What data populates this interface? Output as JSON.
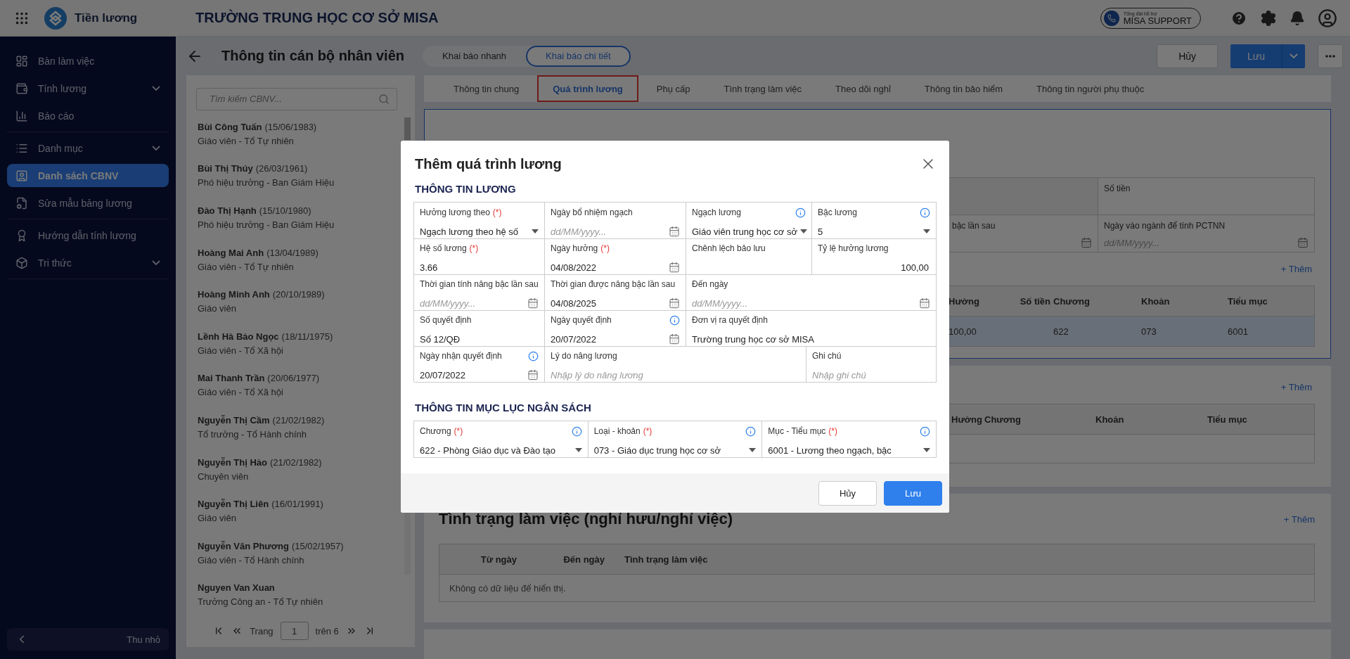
{
  "app": {
    "name": "Tiền lương",
    "organization": "TRƯỜNG TRUNG HỌC CƠ SỞ MISA",
    "support": {
      "caption": "Tổng đài hỗ trợ",
      "label": "MISA SUPPORT"
    }
  },
  "sidebar": {
    "sections": [
      {
        "items": [
          {
            "label": "Bàn làm việc",
            "has_submenu": false,
            "selected": false
          },
          {
            "label": "Tính lương",
            "has_submenu": true,
            "selected": false
          },
          {
            "label": "Báo cáo",
            "has_submenu": false,
            "selected": false
          }
        ]
      },
      {
        "items": [
          {
            "label": "Danh mục",
            "has_submenu": true,
            "selected": false
          },
          {
            "label": "Danh sách CBNV",
            "has_submenu": false,
            "selected": true
          },
          {
            "label": "Sửa mẫu bảng lương",
            "has_submenu": false,
            "selected": false
          }
        ]
      },
      {
        "items": [
          {
            "label": "Hướng dẫn tính lương",
            "has_submenu": false,
            "selected": false
          },
          {
            "label": "Tri thức",
            "has_submenu": true,
            "selected": false
          }
        ]
      }
    ],
    "collapse_label": "Thu nhỏ"
  },
  "page": {
    "title": "Thông tin cán bộ nhân viên",
    "modes": [
      {
        "label": "Khai báo nhanh",
        "selected": false
      },
      {
        "label": "Khai báo chi tiết",
        "selected": true
      }
    ],
    "cancel": "Hủy",
    "save": "Lưu"
  },
  "employees": {
    "search_placeholder": "Tìm kiếm CBNV...",
    "items": [
      {
        "name": "Bùi Công Tuấn",
        "dob": "(15/06/1983)",
        "role": "Giáo viên - Tổ Tự nhiên"
      },
      {
        "name": "Bùi Thị Thúy",
        "dob": "(26/03/1961)",
        "role": "Phó hiệu trưởng - Ban Giám Hiệu"
      },
      {
        "name": "Đào Thị Hạnh",
        "dob": "(15/10/1980)",
        "role": "Phó hiệu trưởng - Ban Giám Hiệu"
      },
      {
        "name": "Hoàng Mai Anh",
        "dob": "(13/04/1989)",
        "role": "Giáo viên - Tổ Tự nhiên"
      },
      {
        "name": "Hoàng Minh Anh",
        "dob": "(20/10/1989)",
        "role": "Giáo viên"
      },
      {
        "name": "Lềnh Hà Bảo Ngọc",
        "dob": "(18/11/1975)",
        "role": "Giáo viên - Tổ Xã hội"
      },
      {
        "name": "Mai Thanh Trần",
        "dob": "(20/06/1977)",
        "role": "Giáo viên - Tổ Xã hội"
      },
      {
        "name": "Nguyễn Thị Cầm",
        "dob": "(21/02/1982)",
        "role": "Tổ trưởng - Tổ Hành chính"
      },
      {
        "name": "Nguyễn Thị Hảo",
        "dob": "(21/02/1982)",
        "role": "Chuyên viên"
      },
      {
        "name": "Nguyễn Thị Liên",
        "dob": "(16/01/1991)",
        "role": "Giáo viên"
      },
      {
        "name": "Nguyễn Văn Phương",
        "dob": "(15/02/1957)",
        "role": "Giáo viên - Tổ Hành chính"
      },
      {
        "name": "Nguyen Van Xuan",
        "role": "Trưởng Công an - Tổ Tự nhiên"
      }
    ],
    "pagination": {
      "label": "Trang",
      "page": "1",
      "total": "trên 6"
    }
  },
  "tabs": [
    {
      "label": "Thông tin chung",
      "selected": false
    },
    {
      "label": "Quá trình lương",
      "selected": true
    },
    {
      "label": "Phụ cấp",
      "selected": false
    },
    {
      "label": "Tình trạng làm việc",
      "selected": false
    },
    {
      "label": "Theo dõi nghỉ",
      "selected": false
    },
    {
      "label": "Thông tin bảo hiểm",
      "selected": false
    },
    {
      "label": "Thông tin người phụ thuộc",
      "selected": false
    }
  ],
  "salary_card": {
    "fields": [
      {
        "label": "Số tiền",
        "kind": "text"
      },
      {
        "label": "bậc lần sau",
        "kind": "date"
      },
      {
        "label": "Ngày vào ngành để tính PCTNN",
        "kind": "date",
        "placeholder": "dd/MM/yyyy..."
      }
    ],
    "add_label": "+ Thêm",
    "columns": [
      "Hưởng",
      "Số tiền",
      "Chương",
      "Khoản",
      "Tiểu mục"
    ],
    "rows": [
      {
        "selected": true,
        "huong": "100,00",
        "chuong": "622",
        "khoan": "073",
        "tieu_muc": "6001"
      }
    ]
  },
  "allowance_card": {
    "add_label": "+ Thêm",
    "columns": [
      "Hưởng",
      "Chương",
      "Khoản",
      "Tiểu mục"
    ]
  },
  "work_status_card": {
    "title": "Tình trạng làm việc (nghỉ hưu/nghỉ việc)",
    "add_label": "+ Thêm",
    "columns": [
      "Từ ngày",
      "Đến ngày",
      "Tình trạng làm việc"
    ],
    "empty_text": "Không có dữ liệu để hiển thị."
  },
  "dialog": {
    "title": "Thêm quá trình lương",
    "salary_section": {
      "heading": "THÔNG TIN LƯƠNG",
      "fields": [
        {
          "label": "Hưởng lương theo",
          "required_mark": "(*)",
          "info": false,
          "kind": "select",
          "value": "Ngạch lương theo hệ số"
        },
        {
          "label": "Ngày bổ nhiệm ngạch",
          "info": false,
          "kind": "date",
          "placeholder": "dd/MM/yyyy..."
        },
        {
          "label": "Ngạch lương",
          "info": true,
          "kind": "select",
          "value": "Giáo viên trung học cơ sở"
        },
        {
          "label": "Bậc lương",
          "info": true,
          "kind": "select",
          "value": "5"
        },
        {
          "label": "Hệ số lương",
          "required_mark": "(*)",
          "info": false,
          "kind": "text",
          "value": "3.66"
        },
        {
          "label": "Ngày hưởng",
          "required_mark": "(*)",
          "info": false,
          "kind": "date",
          "value": "04/08/2022"
        },
        {
          "label": "Chênh lệch bảo lưu",
          "info": false,
          "kind": "text"
        },
        {
          "label": "Tỷ lệ hưởng lương",
          "info": false,
          "kind": "number",
          "value": "100,00"
        },
        {
          "label": "Thời gian tính nâng bậc lần sau",
          "info": false,
          "kind": "date",
          "placeholder": "dd/MM/yyyy..."
        },
        {
          "label": "Thời gian được nâng bậc lần sau",
          "info": false,
          "kind": "date",
          "value": "04/08/2025"
        },
        {
          "label": "Đến ngày",
          "info": false,
          "kind": "date",
          "placeholder": "dd/MM/yyyy..."
        },
        {
          "label": "Số quyết định",
          "info": false,
          "kind": "text",
          "value": "Số 12/QĐ"
        },
        {
          "label": "Ngày quyết định",
          "info": true,
          "kind": "date",
          "value": "20/07/2022"
        },
        {
          "label": "Đơn vị ra quyết định",
          "info": false,
          "kind": "text",
          "value": "Trường trung học cơ sở MISA"
        },
        {
          "label": "Ngày nhận quyết định",
          "info": true,
          "kind": "date",
          "value": "20/07/2022"
        },
        {
          "label": "Lý do nâng lương",
          "info": false,
          "kind": "text",
          "placeholder": "Nhập lý do nâng lương"
        },
        {
          "label": "Ghi chú",
          "info": false,
          "kind": "text",
          "placeholder": "Nhập ghi chú"
        }
      ]
    },
    "budget_section": {
      "heading": "THÔNG TIN MỤC LỤC NGÂN SÁCH",
      "fields": [
        {
          "label": "Chương",
          "required_mark": "(*)",
          "info": true,
          "kind": "select",
          "value": "622 - Phòng Giáo dục và Đào tạo"
        },
        {
          "label": "Loại - khoản",
          "required_mark": "(*)",
          "info": true,
          "kind": "select",
          "value": "073 - Giáo dục trung học cơ sở"
        },
        {
          "label": "Mục - Tiểu mục",
          "required_mark": "(*)",
          "info": true,
          "kind": "select",
          "value": "6001 - Lương theo ngạch, bậc"
        }
      ]
    },
    "cancel": "Hủy",
    "save": "Lưu"
  }
}
